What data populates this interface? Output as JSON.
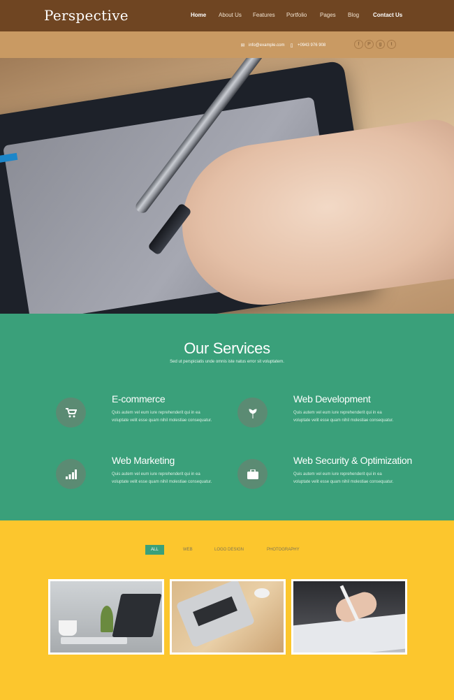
{
  "brand": {
    "name": "Perspective"
  },
  "nav": {
    "items": [
      {
        "label": "Home"
      },
      {
        "label": "About Us"
      },
      {
        "label": "Features"
      },
      {
        "label": "Portfolio"
      },
      {
        "label": "Pages"
      },
      {
        "label": "Blog"
      },
      {
        "label": "Contact Us"
      }
    ]
  },
  "contact": {
    "email": "info@example.com",
    "phone": "+0943 976 908"
  },
  "social": [
    {
      "icon": "facebook-icon",
      "glyph": "f"
    },
    {
      "icon": "pinterest-icon",
      "glyph": "P"
    },
    {
      "icon": "google-plus-icon",
      "glyph": "g"
    },
    {
      "icon": "twitter-icon",
      "glyph": "t"
    }
  ],
  "services": {
    "title": "Our Services",
    "subtitle": "Sed ut perspiciatis unde omnis iste natus error sit voluptatem.",
    "items": [
      {
        "name": "E-commerce",
        "icon": "cart-icon",
        "desc": "Quis autem vel eum iure reprehenderit qui in ea voluptate velit esse quam nihil molestiae consequatur."
      },
      {
        "name": "Web Development",
        "icon": "leaf-icon",
        "desc": "Quis autem vel eum iure reprehenderit qui in ea voluptate velit esse quam nihil molestiae consequatur."
      },
      {
        "name": "Web Marketing",
        "icon": "bar-chart-icon",
        "desc": "Quis autem vel eum iure reprehenderit qui in ea voluptate velit esse quam nihil molestiae consequatur."
      },
      {
        "name": "Web Security & Optimization",
        "icon": "briefcase-icon",
        "desc": "Quis autem vel eum iure reprehenderit qui in ea voluptate velit esse quam nihil molestiae consequatur."
      }
    ]
  },
  "portfolio": {
    "filters": [
      {
        "label": "ALL"
      },
      {
        "label": "WEB"
      },
      {
        "label": "LOGO DESIGN"
      },
      {
        "label": "PHOTOGRAPHY"
      }
    ]
  },
  "colors": {
    "nav_bg": "#6f4522",
    "info_bg": "#c99a63",
    "services_bg": "#3aa07a",
    "portfolio_bg": "#fcc62d"
  }
}
